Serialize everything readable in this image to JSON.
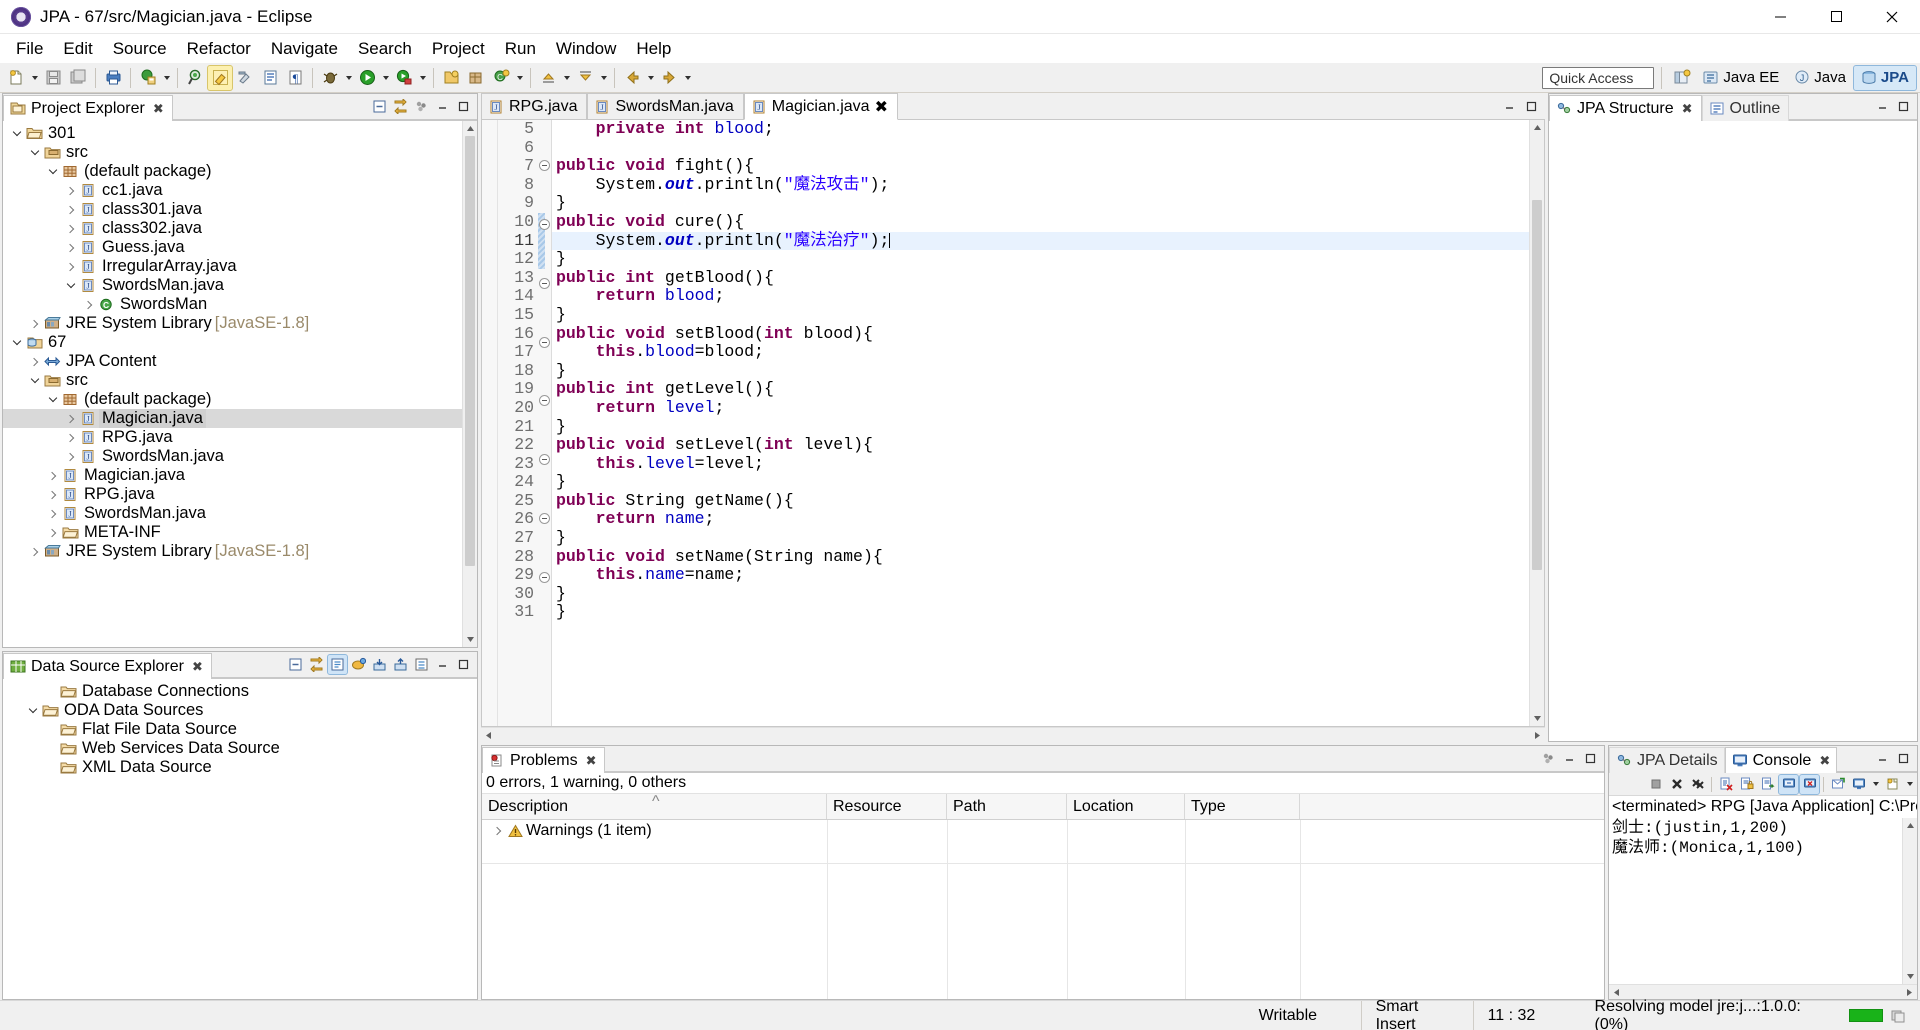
{
  "window": {
    "title": "JPA - 67/src/Magician.java - Eclipse",
    "minimize": "–",
    "maximize": "□",
    "close": "✕"
  },
  "menubar": [
    "File",
    "Edit",
    "Source",
    "Refactor",
    "Navigate",
    "Search",
    "Project",
    "Run",
    "Window",
    "Help"
  ],
  "toolbar": {
    "quick_access_placeholder": "Quick Access",
    "perspectives": [
      {
        "label": "Java EE",
        "selected": false
      },
      {
        "label": "Java",
        "selected": false
      },
      {
        "label": "JPA",
        "selected": true
      }
    ]
  },
  "project_explorer": {
    "title": "Project Explorer",
    "close_glyph": "✖",
    "nodes": [
      {
        "depth": 0,
        "twisty": "expanded",
        "icon": "project-open-icon",
        "label": "301",
        "suffix": "",
        "selected": false
      },
      {
        "depth": 1,
        "twisty": "expanded",
        "icon": "source-folder-icon",
        "label": "src",
        "suffix": "",
        "selected": false
      },
      {
        "depth": 2,
        "twisty": "expanded",
        "icon": "package-icon",
        "label": "(default package)",
        "suffix": "",
        "selected": false
      },
      {
        "depth": 3,
        "twisty": "collapsed",
        "icon": "java-file-icon",
        "label": "cc1.java",
        "suffix": "",
        "selected": false
      },
      {
        "depth": 3,
        "twisty": "collapsed",
        "icon": "java-file-icon",
        "label": "class301.java",
        "suffix": "",
        "selected": false
      },
      {
        "depth": 3,
        "twisty": "collapsed",
        "icon": "java-file-icon",
        "label": "class302.java",
        "suffix": "",
        "selected": false
      },
      {
        "depth": 3,
        "twisty": "collapsed",
        "icon": "java-file-icon",
        "label": "Guess.java",
        "suffix": "",
        "selected": false
      },
      {
        "depth": 3,
        "twisty": "collapsed",
        "icon": "java-file-icon",
        "label": "IrregularArray.java",
        "suffix": "",
        "selected": false
      },
      {
        "depth": 3,
        "twisty": "expanded",
        "icon": "java-file-icon",
        "label": "SwordsMan.java",
        "suffix": "",
        "selected": false
      },
      {
        "depth": 4,
        "twisty": "collapsed",
        "icon": "java-class-icon",
        "label": "SwordsMan",
        "suffix": "",
        "selected": false
      },
      {
        "depth": 1,
        "twisty": "collapsed",
        "icon": "jre-library-icon",
        "label": "JRE System Library",
        "suffix": "[JavaSE-1.8]",
        "selected": false
      },
      {
        "depth": 0,
        "twisty": "expanded",
        "icon": "jpa-project-icon",
        "label": "67",
        "suffix": "",
        "selected": false
      },
      {
        "depth": 1,
        "twisty": "collapsed",
        "icon": "jpa-content-icon",
        "label": "JPA Content",
        "suffix": "",
        "selected": false
      },
      {
        "depth": 1,
        "twisty": "expanded",
        "icon": "source-folder-icon",
        "label": "src",
        "suffix": "",
        "selected": false
      },
      {
        "depth": 2,
        "twisty": "expanded",
        "icon": "package-icon",
        "label": "(default package)",
        "suffix": "",
        "selected": false
      },
      {
        "depth": 3,
        "twisty": "collapsed",
        "icon": "java-file-icon",
        "label": "Magician.java",
        "suffix": "",
        "selected": true
      },
      {
        "depth": 3,
        "twisty": "collapsed",
        "icon": "java-file-icon",
        "label": "RPG.java",
        "suffix": "",
        "selected": false
      },
      {
        "depth": 3,
        "twisty": "collapsed",
        "icon": "java-file-icon",
        "label": "SwordsMan.java",
        "suffix": "",
        "selected": false
      },
      {
        "depth": 2,
        "twisty": "collapsed",
        "icon": "java-file-icon",
        "label": "Magician.java",
        "suffix": "",
        "selected": false
      },
      {
        "depth": 2,
        "twisty": "collapsed",
        "icon": "java-file-icon",
        "label": "RPG.java",
        "suffix": "",
        "selected": false
      },
      {
        "depth": 2,
        "twisty": "collapsed",
        "icon": "java-file-icon",
        "label": "SwordsMan.java",
        "suffix": "",
        "selected": false
      },
      {
        "depth": 2,
        "twisty": "collapsed",
        "icon": "folder-icon",
        "label": "META-INF",
        "suffix": "",
        "selected": false
      },
      {
        "depth": 1,
        "twisty": "collapsed",
        "icon": "jre-library-icon",
        "label": "JRE System Library",
        "suffix": "[JavaSE-1.8]",
        "selected": false
      }
    ]
  },
  "data_source_explorer": {
    "title": "Data Source Explorer",
    "close_glyph": "✖",
    "nodes": [
      {
        "depth": 1,
        "twisty": "none",
        "icon": "folder-icon",
        "label": "Database Connections"
      },
      {
        "depth": 0,
        "twisty": "expanded",
        "icon": "folder-icon",
        "label": "ODA Data Sources"
      },
      {
        "depth": 1,
        "twisty": "none",
        "icon": "folder-icon",
        "label": "Flat File Data Source"
      },
      {
        "depth": 1,
        "twisty": "none",
        "icon": "folder-icon",
        "label": "Web Services Data Source"
      },
      {
        "depth": 1,
        "twisty": "none",
        "icon": "folder-icon",
        "label": "XML Data Source"
      }
    ]
  },
  "editor": {
    "tabs": [
      {
        "label": "RPG.java",
        "active": false,
        "close_glyph": ""
      },
      {
        "label": "SwordsMan.java",
        "active": false,
        "close_glyph": ""
      },
      {
        "label": "Magician.java",
        "active": true,
        "close_glyph": "✖"
      }
    ],
    "first_line": 5,
    "highlight_line": 11,
    "changed_lines": [
      10,
      11,
      12
    ],
    "fold_lines": [
      7,
      10,
      13,
      16,
      19,
      22,
      25,
      28
    ],
    "lines": [
      {
        "n": 5,
        "tokens": [
          {
            "t": "    ",
            "c": "plain"
          },
          {
            "t": "private int ",
            "c": "kw"
          },
          {
            "t": "blood",
            "c": "fld"
          },
          {
            "t": ";",
            "c": "plain"
          }
        ]
      },
      {
        "n": 6,
        "tokens": [
          {
            "t": "",
            "c": "plain"
          }
        ]
      },
      {
        "n": 7,
        "tokens": [
          {
            "t": "public void ",
            "c": "kw"
          },
          {
            "t": "fight(){",
            "c": "plain"
          }
        ]
      },
      {
        "n": 8,
        "tokens": [
          {
            "t": "    System.",
            "c": "plain"
          },
          {
            "t": "out",
            "c": "stc"
          },
          {
            "t": ".println(",
            "c": "plain"
          },
          {
            "t": "\"魔法攻击\"",
            "c": "str"
          },
          {
            "t": ");",
            "c": "plain"
          }
        ]
      },
      {
        "n": 9,
        "tokens": [
          {
            "t": "}",
            "c": "plain"
          }
        ]
      },
      {
        "n": 10,
        "tokens": [
          {
            "t": "public void ",
            "c": "kw"
          },
          {
            "t": "cure(){",
            "c": "plain"
          }
        ]
      },
      {
        "n": 11,
        "tokens": [
          {
            "t": "    System.",
            "c": "plain"
          },
          {
            "t": "out",
            "c": "stc"
          },
          {
            "t": ".println(",
            "c": "plain"
          },
          {
            "t": "\"魔法治疗\"",
            "c": "str"
          },
          {
            "t": ");",
            "c": "plain"
          }
        ]
      },
      {
        "n": 12,
        "tokens": [
          {
            "t": "}",
            "c": "plain"
          }
        ]
      },
      {
        "n": 13,
        "tokens": [
          {
            "t": "public int ",
            "c": "kw"
          },
          {
            "t": "getBlood(){",
            "c": "plain"
          }
        ]
      },
      {
        "n": 14,
        "tokens": [
          {
            "t": "    ",
            "c": "plain"
          },
          {
            "t": "return ",
            "c": "kw"
          },
          {
            "t": "blood",
            "c": "fld"
          },
          {
            "t": ";",
            "c": "plain"
          }
        ]
      },
      {
        "n": 15,
        "tokens": [
          {
            "t": "}",
            "c": "plain"
          }
        ]
      },
      {
        "n": 16,
        "tokens": [
          {
            "t": "public void ",
            "c": "kw"
          },
          {
            "t": "setBlood(",
            "c": "plain"
          },
          {
            "t": "int ",
            "c": "kw"
          },
          {
            "t": "blood){",
            "c": "plain"
          }
        ]
      },
      {
        "n": 17,
        "tokens": [
          {
            "t": "    ",
            "c": "plain"
          },
          {
            "t": "this",
            "c": "kw"
          },
          {
            "t": ".",
            "c": "plain"
          },
          {
            "t": "blood",
            "c": "fld"
          },
          {
            "t": "=blood;",
            "c": "plain"
          }
        ]
      },
      {
        "n": 18,
        "tokens": [
          {
            "t": "}",
            "c": "plain"
          }
        ]
      },
      {
        "n": 19,
        "tokens": [
          {
            "t": "public int ",
            "c": "kw"
          },
          {
            "t": "getLevel(){",
            "c": "plain"
          }
        ]
      },
      {
        "n": 20,
        "tokens": [
          {
            "t": "    ",
            "c": "plain"
          },
          {
            "t": "return ",
            "c": "kw"
          },
          {
            "t": "level",
            "c": "fld"
          },
          {
            "t": ";",
            "c": "plain"
          }
        ]
      },
      {
        "n": 21,
        "tokens": [
          {
            "t": "}",
            "c": "plain"
          }
        ]
      },
      {
        "n": 22,
        "tokens": [
          {
            "t": "public void ",
            "c": "kw"
          },
          {
            "t": "setLevel(",
            "c": "plain"
          },
          {
            "t": "int ",
            "c": "kw"
          },
          {
            "t": "level){",
            "c": "plain"
          }
        ]
      },
      {
        "n": 23,
        "tokens": [
          {
            "t": "    ",
            "c": "plain"
          },
          {
            "t": "this",
            "c": "kw"
          },
          {
            "t": ".",
            "c": "plain"
          },
          {
            "t": "level",
            "c": "fld"
          },
          {
            "t": "=level;",
            "c": "plain"
          }
        ]
      },
      {
        "n": 24,
        "tokens": [
          {
            "t": "}",
            "c": "plain"
          }
        ]
      },
      {
        "n": 25,
        "tokens": [
          {
            "t": "public ",
            "c": "kw"
          },
          {
            "t": "String getName(){",
            "c": "plain"
          }
        ]
      },
      {
        "n": 26,
        "tokens": [
          {
            "t": "    ",
            "c": "plain"
          },
          {
            "t": "return ",
            "c": "kw"
          },
          {
            "t": "name",
            "c": "fld"
          },
          {
            "t": ";",
            "c": "plain"
          }
        ]
      },
      {
        "n": 27,
        "tokens": [
          {
            "t": "}",
            "c": "plain"
          }
        ]
      },
      {
        "n": 28,
        "tokens": [
          {
            "t": "public void ",
            "c": "kw"
          },
          {
            "t": "setName(String name){",
            "c": "plain"
          }
        ]
      },
      {
        "n": 29,
        "tokens": [
          {
            "t": "    ",
            "c": "plain"
          },
          {
            "t": "this",
            "c": "kw"
          },
          {
            "t": ".",
            "c": "plain"
          },
          {
            "t": "name",
            "c": "fld"
          },
          {
            "t": "=name;",
            "c": "plain"
          }
        ]
      },
      {
        "n": 30,
        "tokens": [
          {
            "t": "}",
            "c": "plain"
          }
        ]
      },
      {
        "n": 31,
        "tokens": [
          {
            "t": "}",
            "c": "plain"
          }
        ]
      }
    ]
  },
  "right_views": {
    "jpa_structure_tab": "JPA Structure",
    "outline_tab": "Outline",
    "close_glyph": "✖"
  },
  "problems": {
    "tab_label": "Problems",
    "close_glyph": "✖",
    "summary": "0 errors, 1 warning, 0 others",
    "columns": [
      "Description",
      "Resource",
      "Path",
      "Location",
      "Type"
    ],
    "rows": [
      {
        "description": "Warnings (1 item)",
        "resource": "",
        "path": "",
        "location": "",
        "type": ""
      }
    ]
  },
  "console": {
    "jpa_details_tab": "JPA Details",
    "console_tab": "Console",
    "close_glyph": "✖",
    "launch_label": "<terminated> RPG [Java Application] C:\\Program Fi",
    "output": [
      "剑士:(justin,1,200)",
      "魔法师:(Monica,1,100)"
    ]
  },
  "statusbar": {
    "writable": "Writable",
    "insert_mode": "Smart Insert",
    "cursor_position": "11 : 32",
    "progress_text": "Resolving model jre:j...:1.0.0: (0%)",
    "progress_color": "#19b319"
  }
}
